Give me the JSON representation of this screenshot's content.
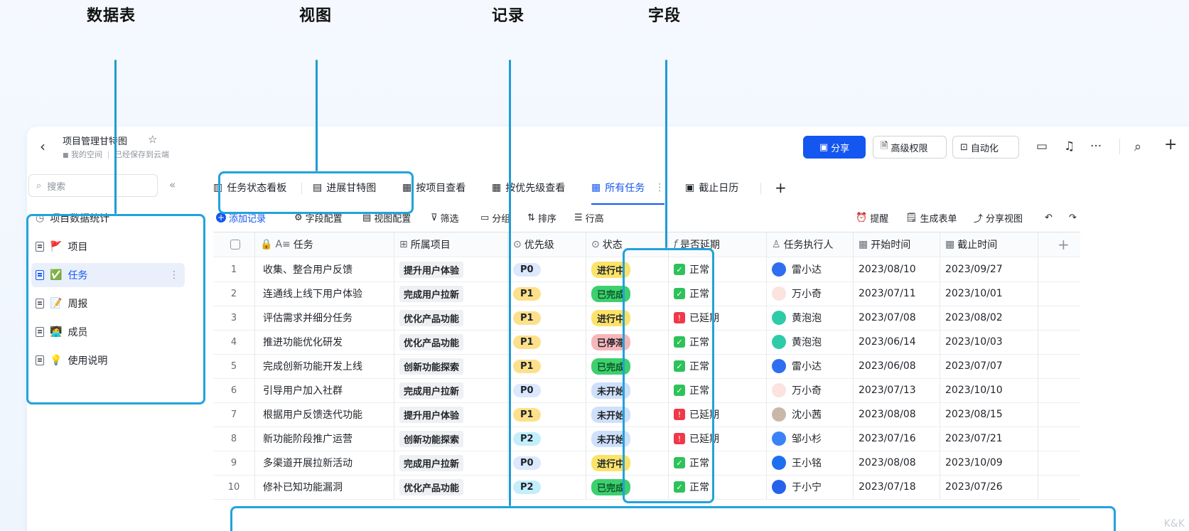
{
  "captions": [
    "数据表",
    "视图",
    "记录",
    "字段"
  ],
  "app": {
    "title": "项目管理甘特图",
    "breadcrumb": "我的空间",
    "save_status": "已经保存到云端",
    "share_label": "分享",
    "permissions_label": "高级权限",
    "automation_label": "自动化",
    "more_label": "···",
    "add_label": "+"
  },
  "sidebar": {
    "search_placeholder": "搜索",
    "collapse_label": "«",
    "items": [
      {
        "label": "项目数据统计",
        "emoji": "",
        "icon": "dashboard-icon"
      },
      {
        "label": "项目",
        "emoji": "🚩",
        "icon": "table-icon"
      },
      {
        "label": "任务",
        "emoji": "✅",
        "icon": "table-icon"
      },
      {
        "label": "周报",
        "emoji": "📝",
        "icon": "table-icon"
      },
      {
        "label": "成员",
        "emoji": "🧑‍💻",
        "icon": "table-icon"
      },
      {
        "label": "使用说明",
        "emoji": "💡",
        "icon": "table-icon"
      }
    ],
    "more_label": "⋮"
  },
  "tabs": [
    "任务状态看板",
    "进展甘特图",
    "按项目查看",
    "按优先级查看",
    "所有任务",
    "截止日历"
  ],
  "tab_add": "+",
  "toolbar": {
    "add_record": "添加记录",
    "field_config": "字段配置",
    "view_config": "视图配置",
    "filter": "筛选",
    "group": "分组",
    "sort": "排序",
    "row_height": "行高",
    "reminder": "提醒",
    "form": "生成表单",
    "share_view": "分享视图"
  },
  "columns": [
    "任务",
    "所属项目",
    "优先级",
    "状态",
    "是否延期",
    "任务执行人",
    "开始时间",
    "截止时间"
  ],
  "column_add": "+",
  "rows": [
    {
      "n": "1",
      "task": "收集、整合用户反馈",
      "project": "提升用户体验",
      "priority": "P0",
      "status": "进行中",
      "delay": "正常",
      "assignee": "雷小达",
      "start": "2023/08/10",
      "end": "2023/09/27"
    },
    {
      "n": "2",
      "task": "连通线上线下用户体验",
      "project": "完成用户拉新",
      "priority": "P1",
      "status": "已完成",
      "delay": "正常",
      "assignee": "万小奇",
      "start": "2023/07/11",
      "end": "2023/10/01"
    },
    {
      "n": "3",
      "task": "评估需求并细分任务",
      "project": "优化产品功能",
      "priority": "P1",
      "status": "进行中",
      "delay": "已延期",
      "assignee": "黄泡泡",
      "start": "2023/07/08",
      "end": "2023/08/02"
    },
    {
      "n": "4",
      "task": "推进功能优化研发",
      "project": "优化产品功能",
      "priority": "P1",
      "status": "已停滞",
      "delay": "正常",
      "assignee": "黄泡泡",
      "start": "2023/06/14",
      "end": "2023/10/03"
    },
    {
      "n": "5",
      "task": "完成创新功能开发上线",
      "project": "创新功能探索",
      "priority": "P1",
      "status": "已完成",
      "delay": "正常",
      "assignee": "雷小达",
      "start": "2023/06/08",
      "end": "2023/07/07"
    },
    {
      "n": "6",
      "task": "引导用户加入社群",
      "project": "完成用户拉新",
      "priority": "P0",
      "status": "未开始",
      "delay": "正常",
      "assignee": "万小奇",
      "start": "2023/07/13",
      "end": "2023/10/10"
    },
    {
      "n": "7",
      "task": "根据用户反馈迭代功能",
      "project": "提升用户体验",
      "priority": "P1",
      "status": "未开始",
      "delay": "已延期",
      "assignee": "沈小茜",
      "start": "2023/08/08",
      "end": "2023/08/15"
    },
    {
      "n": "8",
      "task": "新功能阶段推广运营",
      "project": "创新功能探索",
      "priority": "P2",
      "status": "未开始",
      "delay": "已延期",
      "assignee": "邹小杉",
      "start": "2023/07/16",
      "end": "2023/07/21"
    },
    {
      "n": "9",
      "task": "多渠道开展拉新活动",
      "project": "完成用户拉新",
      "priority": "P0",
      "status": "进行中",
      "delay": "正常",
      "assignee": "王小铭",
      "start": "2023/08/08",
      "end": "2023/10/09"
    },
    {
      "n": "10",
      "task": "修补已知功能漏洞",
      "project": "优化产品功能",
      "priority": "P2",
      "status": "已完成",
      "delay": "正常",
      "assignee": "于小宁",
      "start": "2023/07/18",
      "end": "2023/07/26"
    }
  ],
  "colors": {
    "accent": "#1456f0",
    "highlight": "#22a2dc",
    "status": {
      "进行中": "#fbe36a",
      "已完成": "#3ecf6e",
      "已停滞": "#f7b7ba",
      "未开始": "#cfe0fb"
    },
    "priority": {
      "P0": "#dbe8fd",
      "P1": "#fde08a",
      "P2": "#c3eefb"
    },
    "delay": {
      "正常": "#2ec25b",
      "已延期": "#f0384a"
    }
  },
  "watermark": "K&K"
}
